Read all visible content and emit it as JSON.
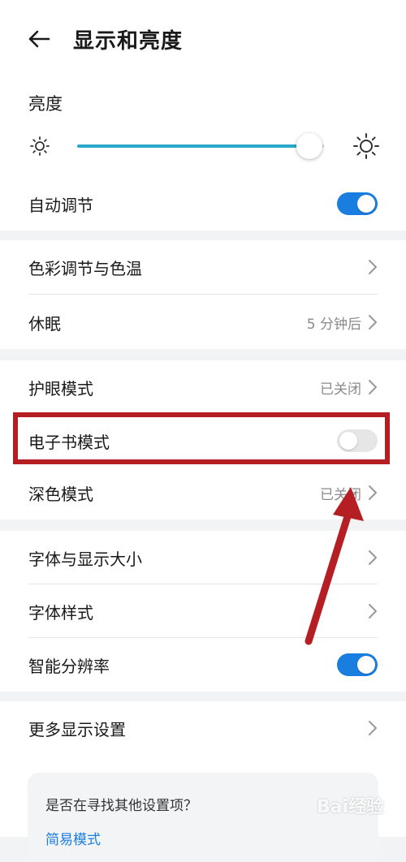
{
  "header": {
    "title": "显示和亮度"
  },
  "brightness": {
    "label": "亮度",
    "level_percent": 94
  },
  "auto_adjust": {
    "label": "自动调节",
    "on": true
  },
  "color_temp": {
    "label": "色彩调节与色温"
  },
  "sleep": {
    "label": "休眠",
    "value": "5 分钟后"
  },
  "eye_comfort": {
    "label": "护眼模式",
    "value": "已关闭"
  },
  "ebook_mode": {
    "label": "电子书模式",
    "on": false
  },
  "dark_mode": {
    "label": "深色模式",
    "value": "已关闭"
  },
  "font_size": {
    "label": "字体与显示大小"
  },
  "font_style": {
    "label": "字体样式"
  },
  "smart_resolution": {
    "label": "智能分辨率",
    "on": true
  },
  "more_display": {
    "label": "更多显示设置"
  },
  "suggest": {
    "question": "是否在寻找其他设置项？",
    "link": "简易模式"
  },
  "watermark": {
    "text": "Bai经验"
  },
  "colors": {
    "accent": "#1a7ee0",
    "slider": "#2aa7c9",
    "highlight": "#b51f24"
  }
}
